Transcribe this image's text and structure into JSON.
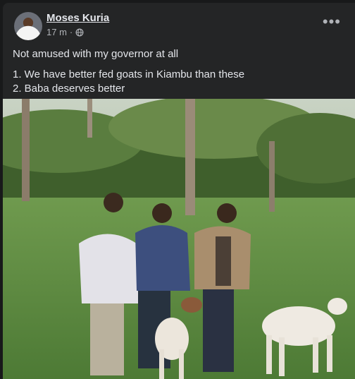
{
  "post": {
    "author": "Moses Kuria",
    "time": "17 m",
    "separator": "·",
    "audience_icon": "globe-icon",
    "more_icon": "more-options-icon",
    "more_glyph": "•••",
    "lines": [
      "Not amused with my governor at all",
      "1. We have better fed goats in Kiambu than these",
      "2. Baba deserves better"
    ]
  },
  "colors": {
    "background": "#18191a",
    "card": "#242526",
    "primary_text": "#e4e6eb",
    "secondary_text": "#b0b3b8"
  }
}
